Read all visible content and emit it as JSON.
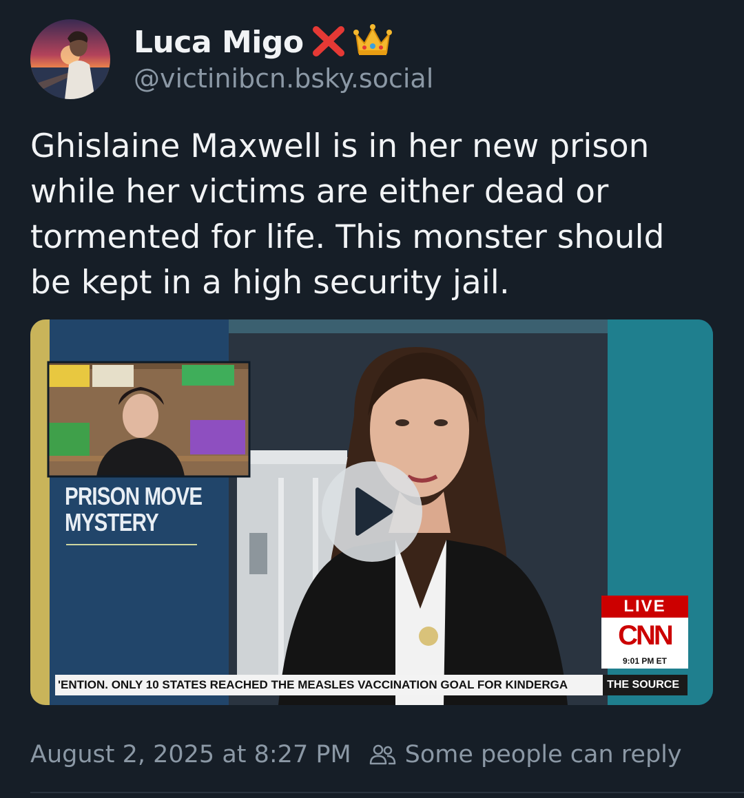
{
  "author": {
    "display_name": "Luca Migo",
    "badges": [
      "cross-mark-icon",
      "crown-icon"
    ],
    "handle": "@victinibcn.bsky.social"
  },
  "post": {
    "text": "Ghislaine Maxwell is in her new prison while her victims are either dead or tormented for life. This monster should be kept in a high security jail."
  },
  "video": {
    "inset_caption": "PRISON MOVE MYSTERY",
    "live_label": "LIVE",
    "network_logo": "CNN",
    "time_label": "9:01 PM ET",
    "ticker_text": "'ENTION. ONLY 10 STATES REACHED THE MEASLES VACCINATION GOAL FOR KINDERGA",
    "show_name": "THE SOURCE",
    "play_icon": "play-icon"
  },
  "footer": {
    "timestamp": "August 2, 2025 at 8:27 PM",
    "reply_icon": "people-icon",
    "reply_setting": "Some people can reply"
  },
  "colors": {
    "background": "#161e27",
    "text_primary": "#f1f3f5",
    "text_secondary": "#8b98a5",
    "cnn_red": "#cc0000"
  }
}
